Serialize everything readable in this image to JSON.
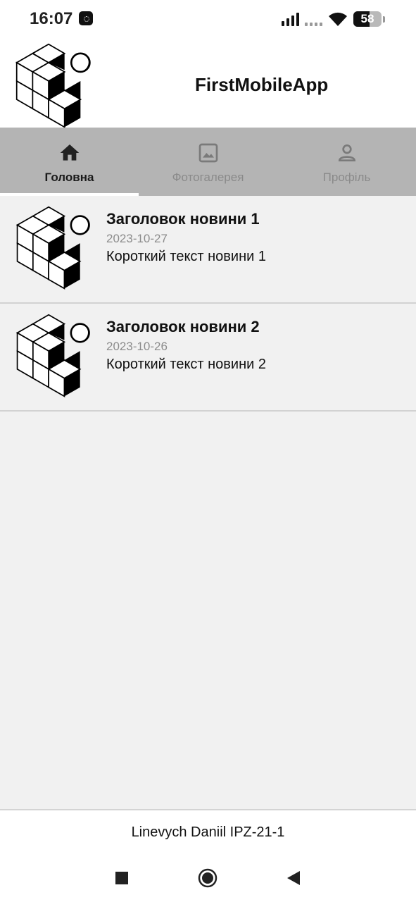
{
  "status_bar": {
    "time": "16:07",
    "battery": "58",
    "battery_level": 0.58,
    "icons": [
      "notification-icon",
      "signal-icon",
      "wifi-icon",
      "battery-icon"
    ]
  },
  "app": {
    "title": "FirstMobileApp",
    "logo_icon": "cubes-logo-icon"
  },
  "tabs": [
    {
      "label": "Головна",
      "icon": "home-icon",
      "active": true
    },
    {
      "label": "Фотогалерея",
      "icon": "image-icon",
      "active": false
    },
    {
      "label": "Профіль",
      "icon": "person-icon",
      "active": false
    }
  ],
  "news": [
    {
      "title": "Заголовок новини 1",
      "date": "2023-10-27",
      "text": "Короткий текст новини 1",
      "icon": "cubes-logo-icon"
    },
    {
      "title": "Заголовок новини 2",
      "date": "2023-10-26",
      "text": "Короткий текст новини 2",
      "icon": "cubes-logo-icon"
    }
  ],
  "footer": {
    "text": "Linevych Daniil IPZ-21-1"
  },
  "system_nav": {
    "icons": [
      "recents-square-icon",
      "home-circle-icon",
      "back-triangle-icon"
    ]
  },
  "colors": {
    "tab_bar_bg": "#b4b4b4",
    "content_bg": "#f1f1f1",
    "active_indicator": "#ffffff"
  }
}
